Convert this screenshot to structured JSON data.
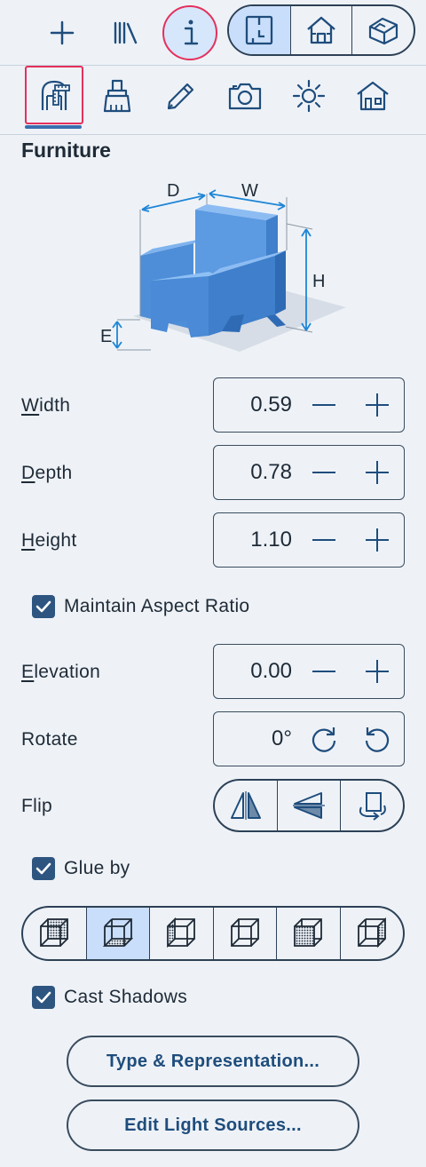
{
  "toolbar": {
    "items": [
      "add-icon",
      "library-icon",
      "info-icon"
    ],
    "view_modes": [
      "floor-plan-icon",
      "elevation-house-icon",
      "3d-view-icon"
    ],
    "active_view": "floor-plan-icon"
  },
  "tabs": [
    "furniture-dimensions-icon",
    "brush-icon",
    "pencil-icon",
    "camera-icon",
    "light-icon",
    "house-icon"
  ],
  "section": {
    "title": "Furniture"
  },
  "diagram": {
    "d": "D",
    "w": "W",
    "h": "H",
    "e": "E"
  },
  "fields": {
    "width": {
      "label_first": "W",
      "label_rest": "idth",
      "value": "0.59"
    },
    "depth": {
      "label_first": "D",
      "label_rest": "epth",
      "value": "0.78"
    },
    "height": {
      "label_first": "H",
      "label_rest": "eight",
      "value": "1.10"
    },
    "elevation": {
      "label_first": "E",
      "label_rest": "levation",
      "value": "0.00"
    },
    "rotate": {
      "label": "Rotate",
      "value": "0°"
    },
    "flip": {
      "label": "Flip"
    }
  },
  "checks": {
    "aspect": {
      "label": "Maintain Aspect Ratio",
      "checked": true
    },
    "glue": {
      "label": "Glue by",
      "checked": true
    },
    "shadows": {
      "label": "Cast Shadows",
      "checked": true
    }
  },
  "glue_options": {
    "selected_index": 1,
    "count": 6
  },
  "buttons": {
    "type_repr": "Type & Representation...",
    "edit_lights": "Edit Light Sources..."
  },
  "colors": {
    "accent": "#2e5580",
    "highlight": "#e5305c",
    "active_bg": "#c9defa",
    "link_text": "#1f4d7c"
  }
}
